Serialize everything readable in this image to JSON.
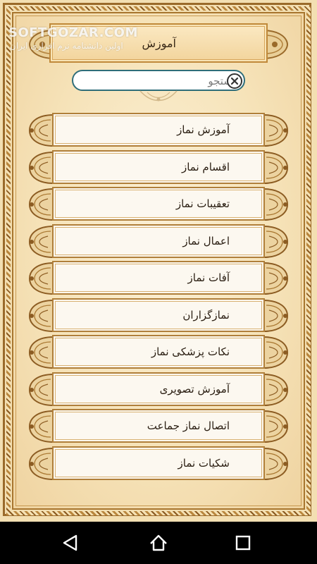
{
  "watermark": {
    "brand": "SOFTGOZAR.COM",
    "tagline": "اولین دانشنامه نرم افزاری ایران"
  },
  "header": {
    "title": "آموزش"
  },
  "search": {
    "placeholder": "جستجو",
    "value": "",
    "clear_icon": "close-circle-icon"
  },
  "menu": {
    "items": [
      {
        "label": "آموزش نماز"
      },
      {
        "label": "اقسام نماز"
      },
      {
        "label": "تعقیبات نماز"
      },
      {
        "label": "اعمال نماز"
      },
      {
        "label": "آفات نماز"
      },
      {
        "label": "نمازگزاران"
      },
      {
        "label": "نکات پزشکی نماز"
      },
      {
        "label": "آموزش تصویری"
      },
      {
        "label": "اتصال نماز جماعت"
      },
      {
        "label": "شکیات نماز"
      }
    ]
  },
  "navbar": {
    "back_icon": "back-triangle-icon",
    "home_icon": "home-circle-icon",
    "recents_icon": "recents-square-icon"
  },
  "colors": {
    "frame": "#9a6a2a",
    "paper": "#f6e3b9",
    "search_border": "#2f6e7a",
    "item_bg": "#fcf8f0",
    "navbar": "#000000"
  }
}
